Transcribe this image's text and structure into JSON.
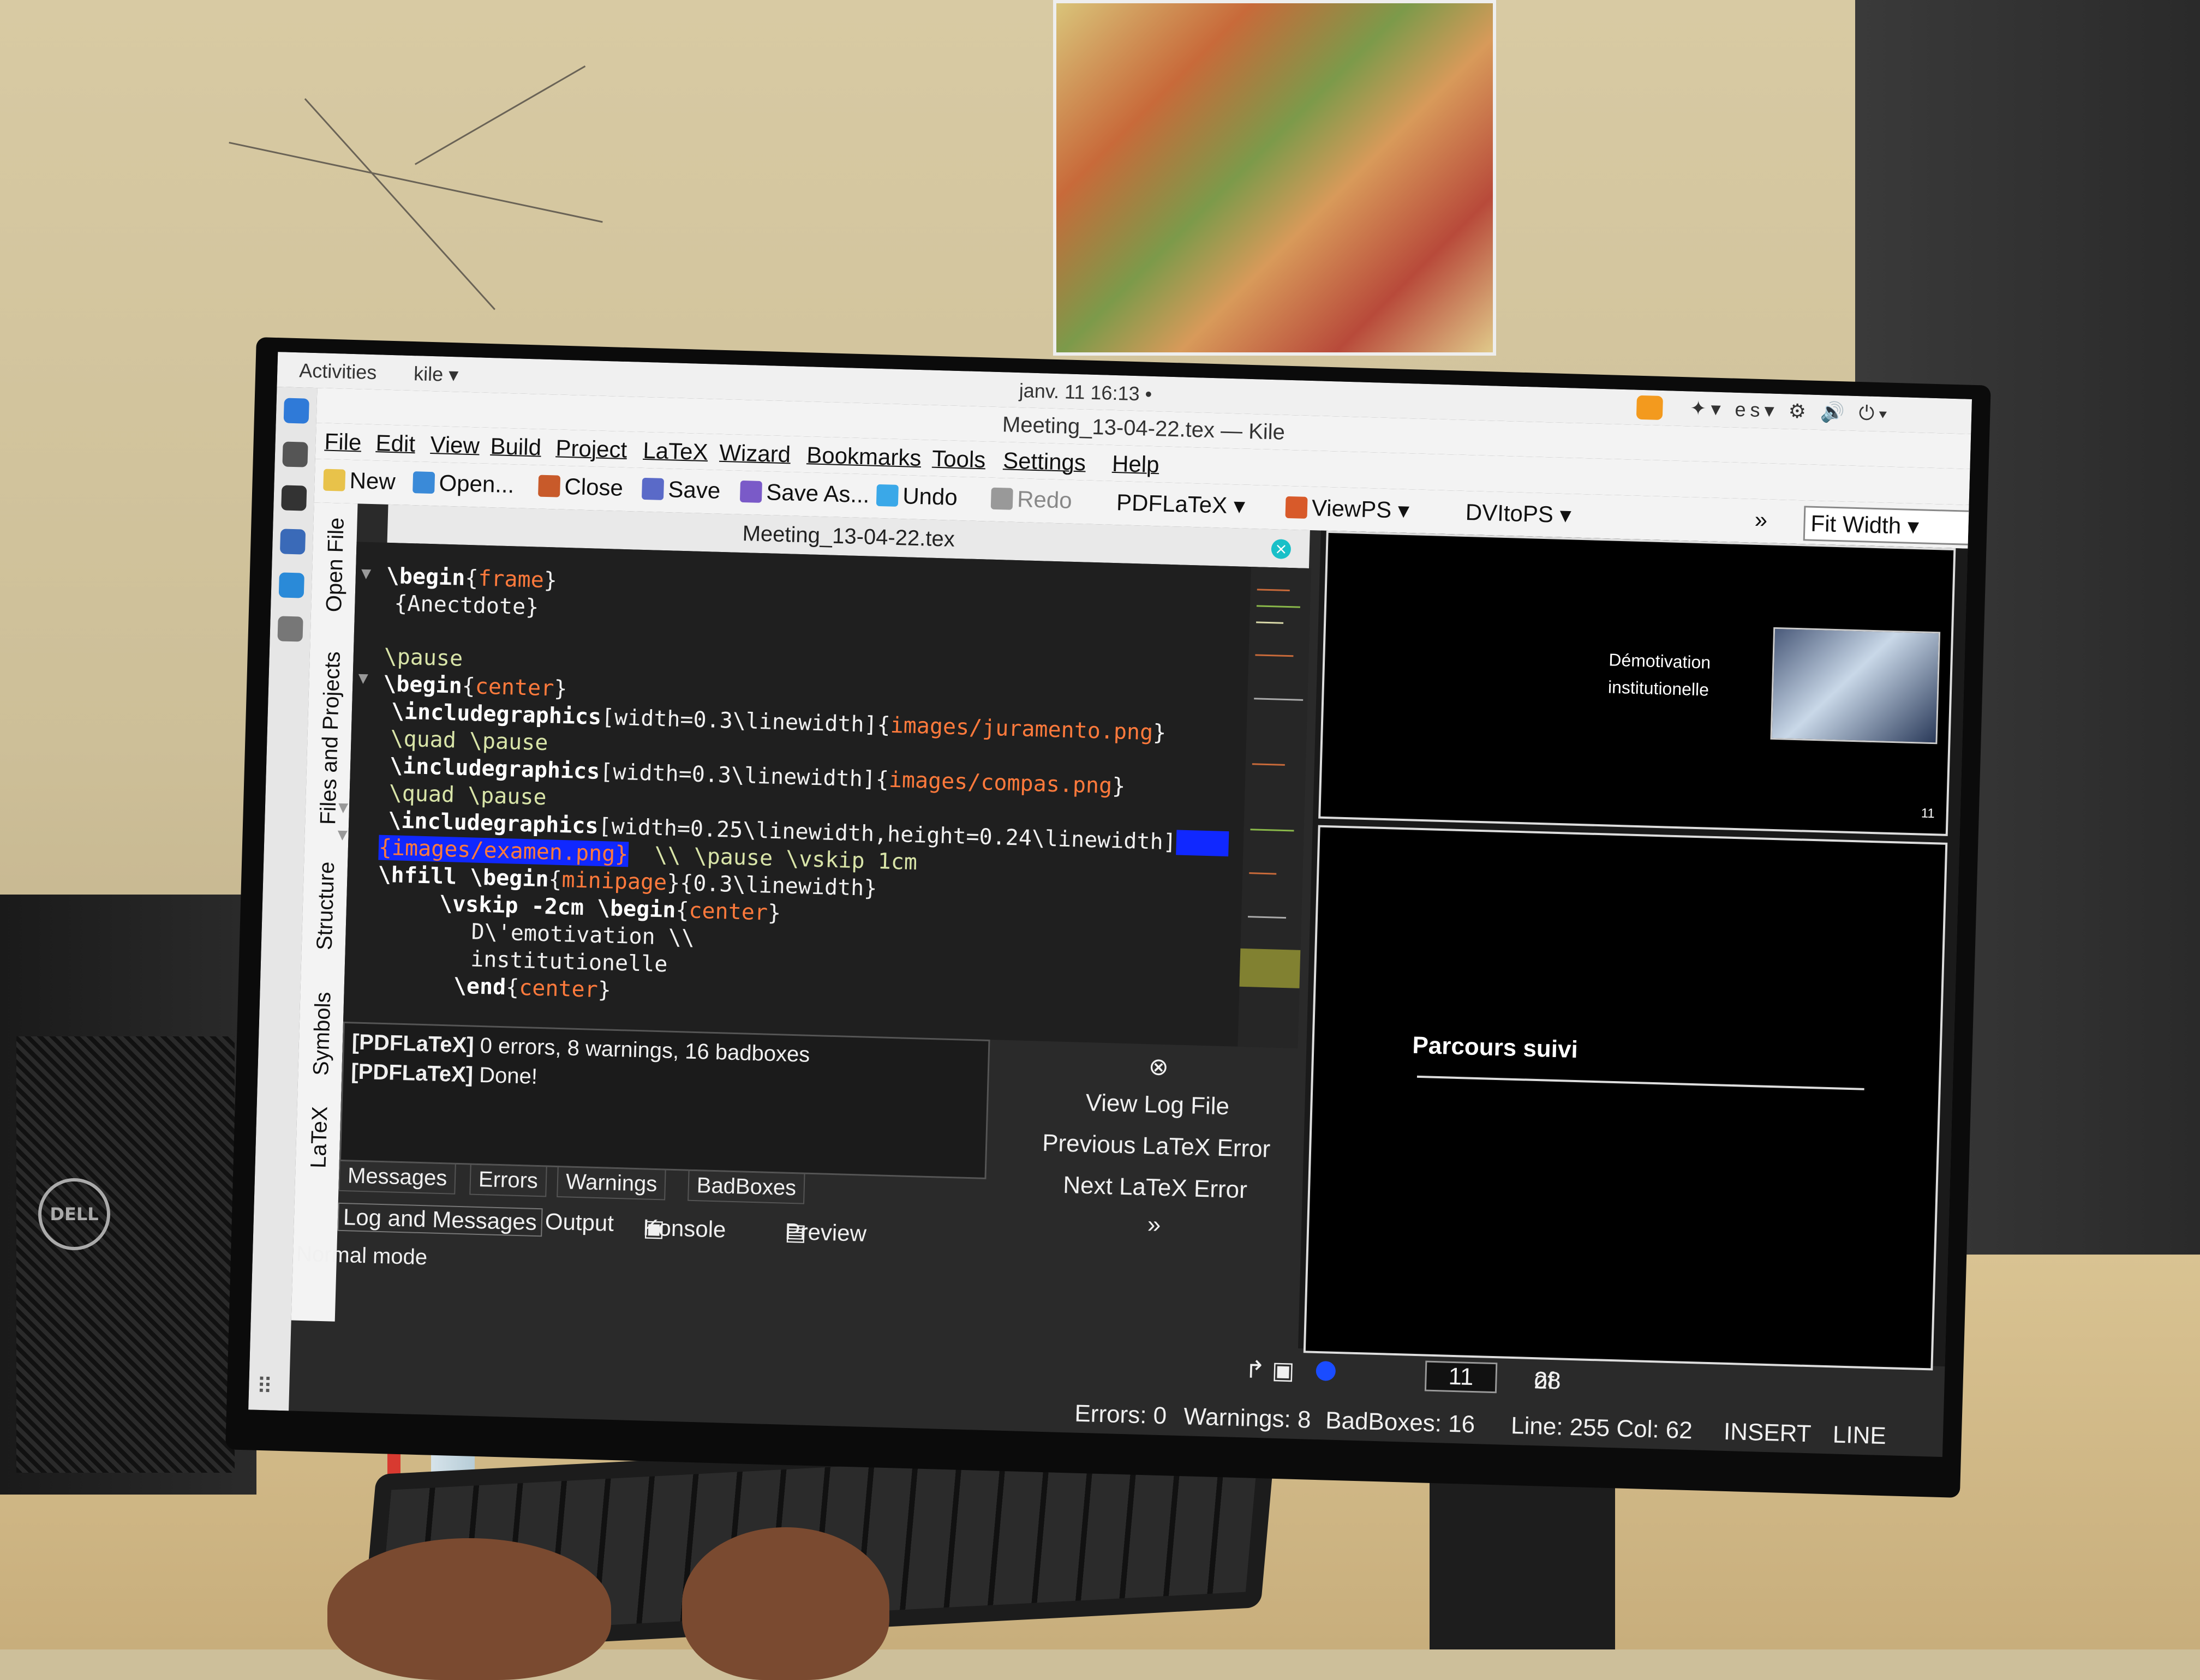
{
  "system_bar": {
    "activities": "Activities",
    "app_name": "kile",
    "datetime": "janv. 11  16:13 •",
    "language": "es"
  },
  "window": {
    "title": "Meeting_13-04-22.tex — Kile"
  },
  "menu": [
    "File",
    "Edit",
    "View",
    "Build",
    "Project",
    "LaTeX",
    "Wizard",
    "Bookmarks",
    "Tools",
    "Settings",
    "Help"
  ],
  "toolbar": {
    "new": "New",
    "open": "Open...",
    "close": "Close",
    "save": "Save",
    "save_as": "Save As...",
    "undo": "Undo",
    "redo": "Redo",
    "compile": "PDFLaTeX",
    "view": "ViewPS",
    "convert": "DVItoPS",
    "zoom": "Fit Width"
  },
  "side_tabs": {
    "open_file": "Open File",
    "files_projects": "Files and Projects",
    "structure": "Structure",
    "symbols": "Symbols",
    "latex": "LaTeX"
  },
  "editor": {
    "tab_title": "Meeting_13-04-22.tex",
    "lines": [
      {
        "cmd": "\\begin",
        "arg": "frame",
        "rest": ""
      },
      {
        "cmd": "",
        "arg": "",
        "rest": "{Anectdote}"
      },
      {
        "cmd": "",
        "arg": "",
        "rest": ""
      },
      {
        "cmd": "\\pause",
        "arg": "",
        "rest": ""
      },
      {
        "cmd": "\\begin",
        "arg": "center",
        "rest": ""
      },
      {
        "cmd": "\\includegraphics",
        "arg": "images/juramento.png",
        "rest": "[width=0.3\\linewidth]"
      },
      {
        "cmd": "\\quad \\pause",
        "arg": "",
        "rest": ""
      },
      {
        "cmd": "\\includegraphics",
        "arg": "images/compas.png",
        "rest": "[width=0.3\\linewidth]"
      },
      {
        "cmd": "\\quad \\pause",
        "arg": "",
        "rest": ""
      },
      {
        "cmd": "\\includegraphics",
        "arg": "",
        "rest": "[width=0.25\\linewidth,height=0.24\\linewidth]"
      },
      {
        "cmd": "",
        "arg": "images/examen.png",
        "rest": "\\\\ \\pause \\vskip 1cm"
      },
      {
        "cmd": "\\hfill \\begin",
        "arg": "minipage",
        "rest": "{0.3\\linewidth}"
      },
      {
        "cmd": "\\vskip -2cm \\begin",
        "arg": "center",
        "rest": ""
      },
      {
        "cmd": "",
        "arg": "",
        "rest": "D\\'emotivation \\\\"
      },
      {
        "cmd": "",
        "arg": "",
        "rest": "institutionelle"
      },
      {
        "cmd": "\\end",
        "arg": "center",
        "rest": ""
      }
    ]
  },
  "log": {
    "line1_tag": "[PDFLaTeX]",
    "line1_text": "0 errors, 8 warnings, 16 badboxes",
    "line2_tag": "[PDFLaTeX]",
    "line2_text": "Done!"
  },
  "message_tabs": [
    "Messages",
    "Errors",
    "Warnings",
    "BadBoxes"
  ],
  "bottom_tabs": [
    "Log and Messages",
    "Output",
    "Konsole",
    "Preview"
  ],
  "mode": "Normal mode",
  "log_actions": {
    "view_log": "View Log File",
    "previous_error": "Previous LaTeX Error",
    "next_error": "Next LaTeX Error"
  },
  "viewer": {
    "slide1_text_a": "Démotivation",
    "slide1_text_b": "institutionelle",
    "slide1_page": "11",
    "slide2_title": "Parcours suivi",
    "current_page": "11",
    "total_pages": "28",
    "of": "of"
  },
  "status": {
    "errors": "Errors: 0",
    "warnings": "Warnings: 8",
    "badboxes": "BadBoxes: 16",
    "position": "Line: 255 Col: 62",
    "mode": "INSERT",
    "selection": "LINE"
  },
  "scene": {
    "pc_brand": "DELL"
  }
}
